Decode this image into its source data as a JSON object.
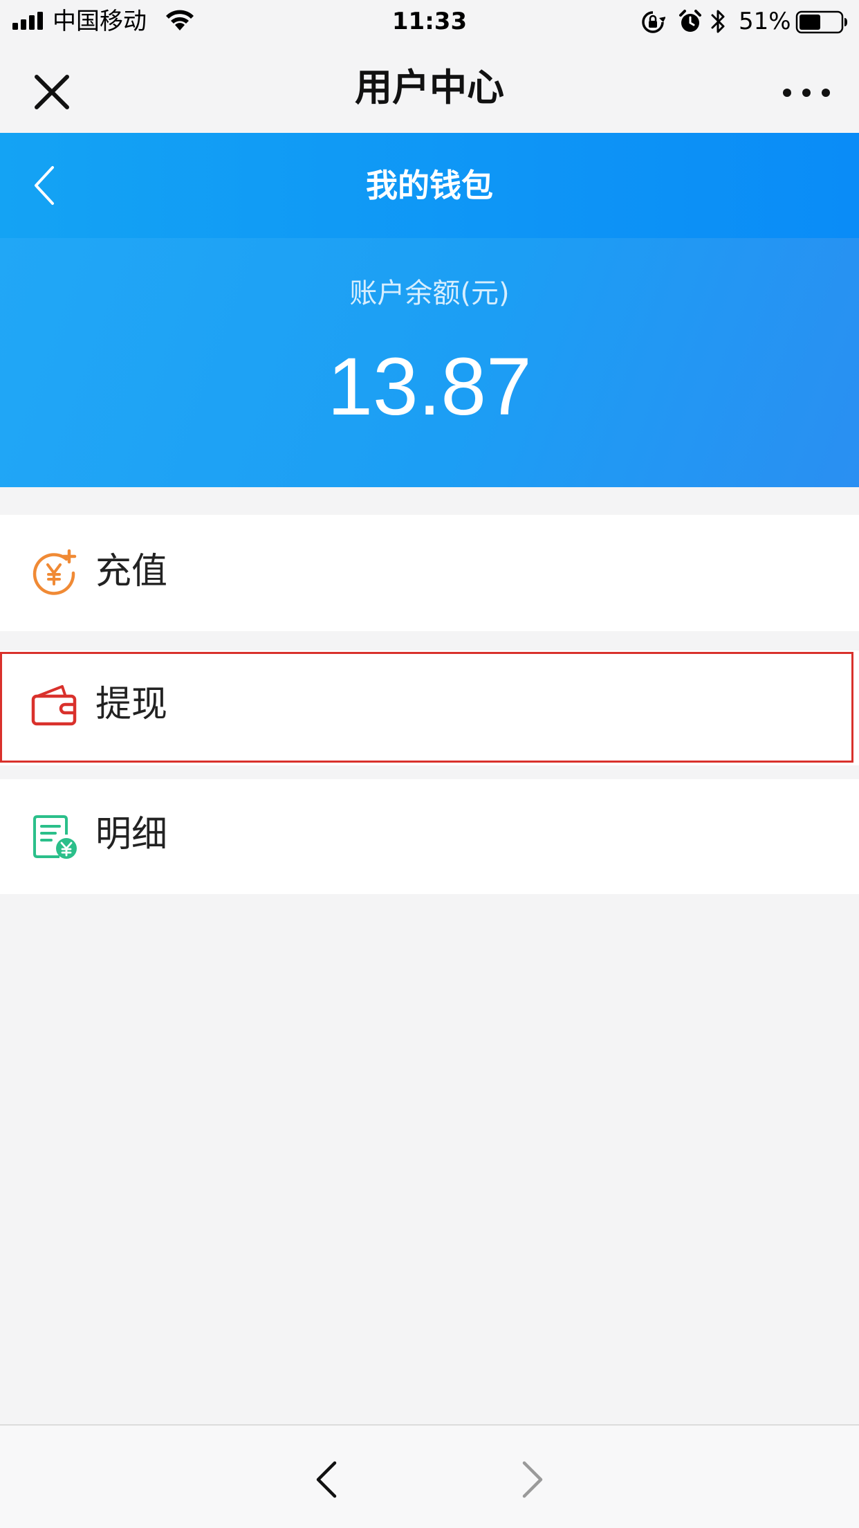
{
  "status_bar": {
    "carrier": "中国移动",
    "time": "11:33",
    "battery_percent": "51%",
    "battery_level": 0.51,
    "icons": [
      "signal-icon",
      "wifi-icon",
      "rotation-lock-icon",
      "alarm-icon",
      "bluetooth-icon",
      "battery-icon"
    ]
  },
  "nav_bar": {
    "title": "用户中心",
    "left_icon": "close-icon",
    "right_icon": "more-icon"
  },
  "wallet": {
    "title": "我的钱包",
    "back_icon": "chevron-left-icon",
    "balance_label": "账户余额(元)",
    "balance_amount": "13.87"
  },
  "menu": {
    "items": [
      {
        "label": "充值",
        "icon": "recharge-icon",
        "color": "#f08a35"
      },
      {
        "label": "提现",
        "icon": "wallet-icon",
        "color": "#d9312c"
      },
      {
        "label": "明细",
        "icon": "bill-detail-icon",
        "color": "#2bbf8a"
      }
    ]
  },
  "bottom_bar": {
    "back_icon": "browser-back-icon",
    "forward_icon": "browser-forward-icon"
  },
  "colors": {
    "header_blue": "#0a8cf7",
    "balance_blue": "#1c9ef4",
    "highlight_red": "#d9312c",
    "background": "#f4f4f5"
  }
}
